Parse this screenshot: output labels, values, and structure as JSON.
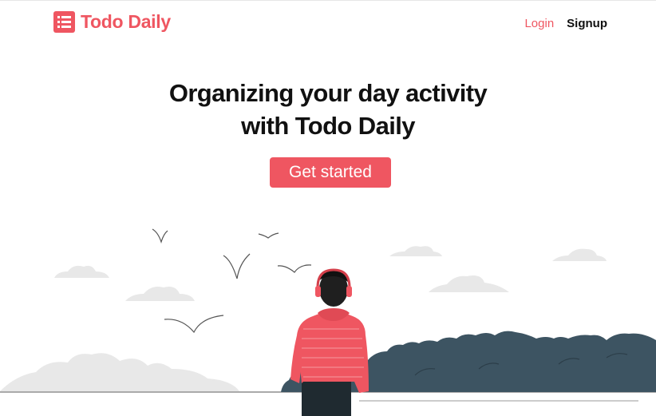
{
  "brand": {
    "name": "Todo Daily",
    "icon": "list-icon",
    "color": "#ef5661"
  },
  "nav": {
    "login": "Login",
    "signup": "Signup"
  },
  "hero": {
    "title_line1": "Organizing your day activity",
    "title_line2": "with Todo Daily",
    "cta": "Get started"
  },
  "illustration": {
    "subject": "person-with-headphones",
    "colors": {
      "shirt": "#ef5661",
      "bushes": "#3d5462",
      "clouds": "#e8e8e8",
      "hair": "#1f1f1f"
    }
  }
}
